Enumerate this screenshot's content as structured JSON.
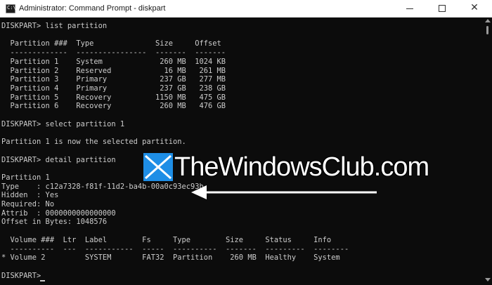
{
  "window": {
    "title": "Administrator: Command Prompt - diskpart",
    "icon_label": "C:\\",
    "controls": {
      "minimize": "minimize-icon",
      "maximize": "maximize-icon",
      "close": "✕"
    }
  },
  "console": {
    "lines": [
      "DISKPART> list partition",
      "",
      "  Partition ###  Type              Size     Offset",
      "  -------------  ----------------  -------  -------",
      "  Partition 1    System             260 MB  1024 KB",
      "  Partition 2    Reserved            16 MB   261 MB",
      "  Partition 3    Primary            237 GB   277 MB",
      "  Partition 4    Primary            237 GB   238 GB",
      "  Partition 5    Recovery          1150 MB   475 GB",
      "  Partition 6    Recovery           260 MB   476 GB",
      "",
      "DISKPART> select partition 1",
      "",
      "Partition 1 is now the selected partition.",
      "",
      "DISKPART> detail partition",
      "",
      "Partition 1",
      "Type    : c12a7328-f81f-11d2-ba4b-00a0c93ec93b",
      "Hidden  : Yes",
      "Required: No",
      "Attrib  : 0000000000000000",
      "Offset in Bytes: 1048576",
      "",
      "  Volume ###  Ltr  Label        Fs     Type        Size     Status     Info",
      "  ----------  ---  -----------  -----  ----------  -------  ---------  --------",
      "* Volume 2         SYSTEM       FAT32  Partition    260 MB  Healthy    System",
      "",
      "DISKPART> "
    ]
  },
  "watermark": {
    "text": "TheWindowsClub.com"
  },
  "colors": {
    "console_bg": "#0c0c0c",
    "console_text": "#cccccc",
    "title_bg": "#ffffff",
    "watermark_blue": "#1e8ee6"
  }
}
